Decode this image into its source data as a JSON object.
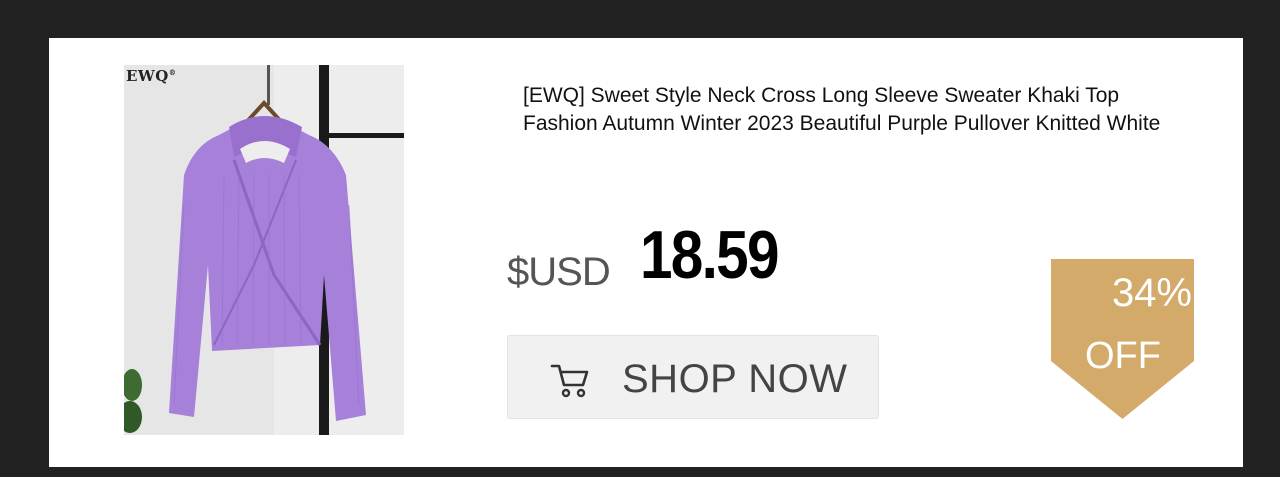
{
  "product": {
    "brand_logo": "EWQ",
    "brand_logo_mark": "®",
    "title": "[EWQ] Sweet Style Neck Cross Long Sleeve Sweater Khaki Top Fashion Autumn Winter 2023 Beautiful Purple Pullover Knitted White",
    "image_icon": "sweater-photo"
  },
  "price": {
    "currency": "$USD",
    "amount": "18.59"
  },
  "shop_button": {
    "label": "SHOP NOW",
    "icon": "shopping-cart-icon"
  },
  "discount": {
    "percent": "34%",
    "off_label": "OFF",
    "badge_color": "#d4aa6a"
  }
}
